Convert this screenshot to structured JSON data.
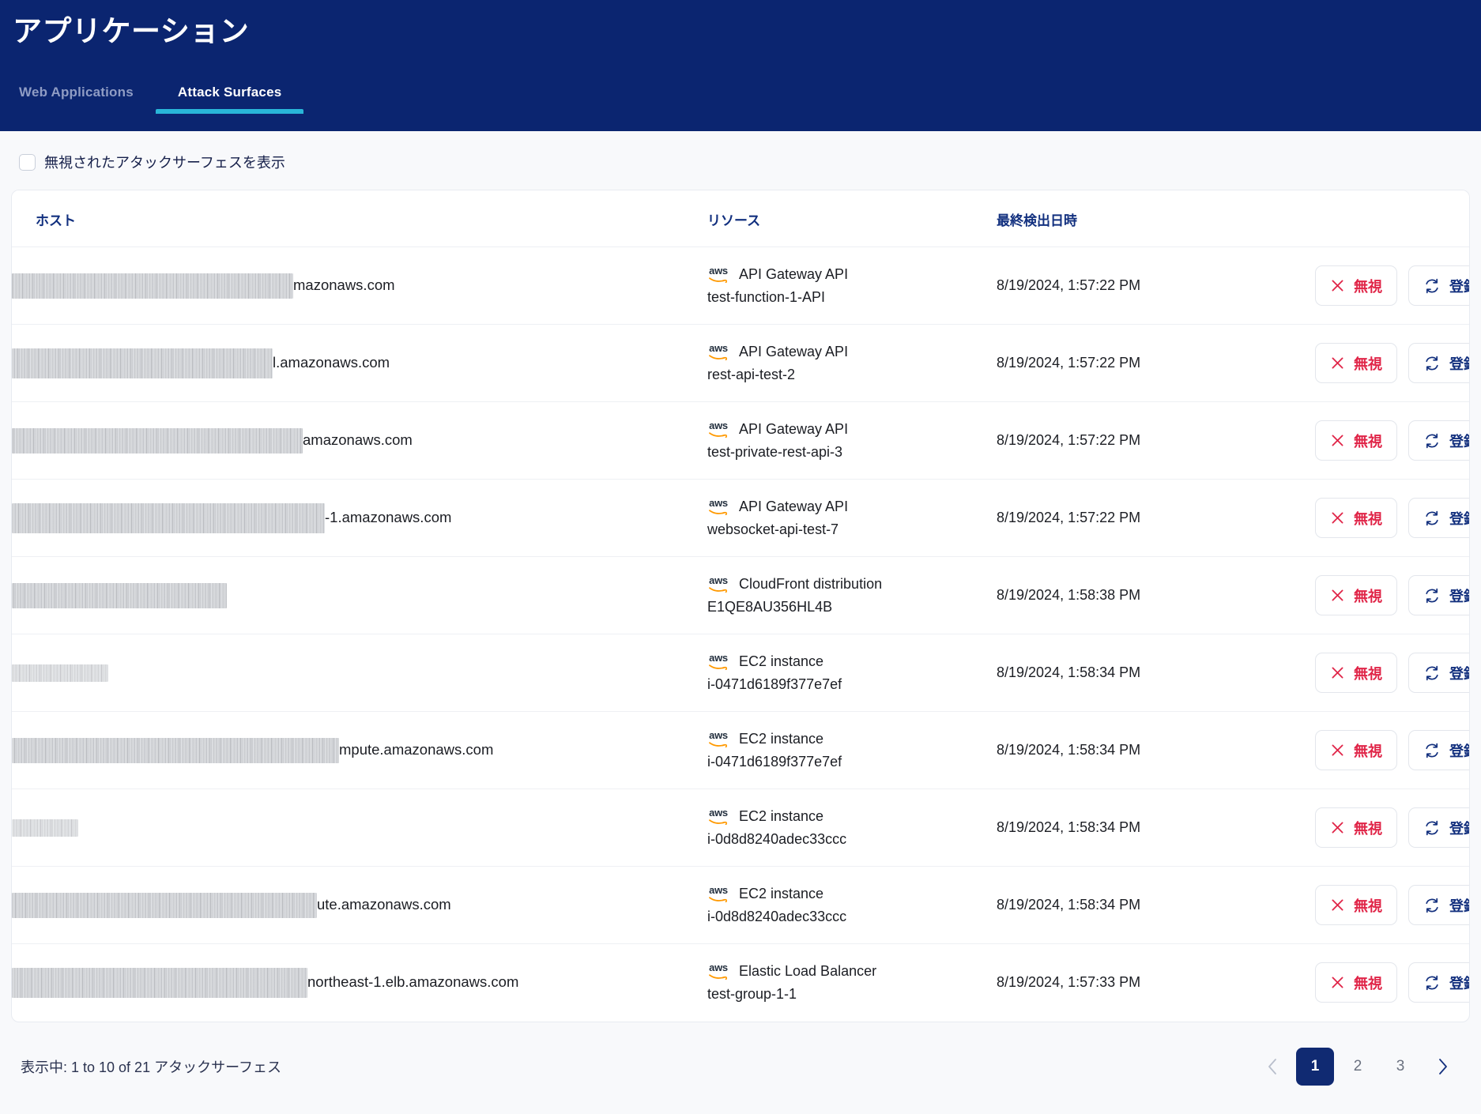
{
  "header": {
    "title": "アプリケーション",
    "tabs": [
      {
        "label": "Web Applications",
        "active": false
      },
      {
        "label": "Attack Surfaces",
        "active": true
      }
    ],
    "bg_color": "#0B2570",
    "accent_color": "#29B6D8"
  },
  "filter": {
    "checkbox_label": "無視されたアタックサーフェスを表示",
    "checked": false
  },
  "table": {
    "columns": {
      "host": "ホスト",
      "resource": "リソース",
      "last_seen": "最終検出日時",
      "actions": ""
    },
    "rows": [
      {
        "host_redacted": true,
        "host_redact_width": 356,
        "host_redact_style": "tall",
        "host_suffix": "mazonaws.com",
        "provider_icon": "aws-logo-icon",
        "resource_type": "API Gateway API",
        "resource_id": "test-function-1-API",
        "last_seen": "8/19/2024, 1:57:22 PM",
        "ignore_label": "無視",
        "register_label": "登録"
      },
      {
        "host_redacted": true,
        "host_redact_width": 330,
        "host_redact_style": "two-line",
        "host_suffix": "l.amazonaws.com",
        "provider_icon": "aws-logo-icon",
        "resource_type": "API Gateway API",
        "resource_id": "rest-api-test-2",
        "last_seen": "8/19/2024, 1:57:22 PM",
        "ignore_label": "無視",
        "register_label": "登録"
      },
      {
        "host_redacted": true,
        "host_redact_width": 368,
        "host_redact_style": "tall",
        "host_suffix": "amazonaws.com",
        "provider_icon": "aws-logo-icon",
        "resource_type": "API Gateway API",
        "resource_id": "test-private-rest-api-3",
        "last_seen": "8/19/2024, 1:57:22 PM",
        "ignore_label": "無視",
        "register_label": "登録"
      },
      {
        "host_redacted": true,
        "host_redact_width": 396,
        "host_redact_style": "two-line",
        "host_suffix": "-1.amazonaws.com",
        "provider_icon": "aws-logo-icon",
        "resource_type": "API Gateway API",
        "resource_id": "websocket-api-test-7",
        "last_seen": "8/19/2024, 1:57:22 PM",
        "ignore_label": "無視",
        "register_label": "登録"
      },
      {
        "host_redacted": true,
        "host_redact_width": 272,
        "host_redact_style": "tall",
        "host_suffix": "",
        "provider_icon": "aws-logo-icon",
        "resource_type": "CloudFront distribution",
        "resource_id": "E1QE8AU356HL4B",
        "last_seen": "8/19/2024, 1:58:38 PM",
        "ignore_label": "無視",
        "register_label": "登録"
      },
      {
        "host_redacted": true,
        "host_redact_width": 122,
        "host_redact_style": "light",
        "host_suffix": "",
        "provider_icon": "aws-logo-icon",
        "resource_type": "EC2 instance",
        "resource_id": "i-0471d6189f377e7ef",
        "last_seen": "8/19/2024, 1:58:34 PM",
        "ignore_label": "無視",
        "register_label": "登録"
      },
      {
        "host_redacted": true,
        "host_redact_width": 414,
        "host_redact_style": "tall",
        "host_suffix": "mpute.amazonaws.com",
        "provider_icon": "aws-logo-icon",
        "resource_type": "EC2 instance",
        "resource_id": "i-0471d6189f377e7ef",
        "last_seen": "8/19/2024, 1:58:34 PM",
        "ignore_label": "無視",
        "register_label": "登録"
      },
      {
        "host_redacted": true,
        "host_redact_width": 84,
        "host_redact_style": "light",
        "host_suffix": "",
        "provider_icon": "aws-logo-icon",
        "resource_type": "EC2 instance",
        "resource_id": "i-0d8d8240adec33ccc",
        "last_seen": "8/19/2024, 1:58:34 PM",
        "ignore_label": "無視",
        "register_label": "登録"
      },
      {
        "host_redacted": true,
        "host_redact_width": 386,
        "host_redact_style": "tall",
        "host_suffix": "ute.amazonaws.com",
        "provider_icon": "aws-logo-icon",
        "resource_type": "EC2 instance",
        "resource_id": "i-0d8d8240adec33ccc",
        "last_seen": "8/19/2024, 1:58:34 PM",
        "ignore_label": "無視",
        "register_label": "登録"
      },
      {
        "host_redacted": true,
        "host_redact_width": 374,
        "host_redact_style": "two-line",
        "host_suffix": "northeast-1.elb.amazonaws.com",
        "provider_icon": "aws-logo-icon",
        "resource_type": "Elastic Load Balancer",
        "resource_id": "test-group-1-1",
        "last_seen": "8/19/2024, 1:57:33 PM",
        "ignore_label": "無視",
        "register_label": "登録"
      }
    ]
  },
  "footer": {
    "count_text": "表示中: 1 to 10 of 21 アタックサーフェス",
    "pagination": {
      "prev_label": "‹",
      "next_label": "›",
      "prev_enabled": false,
      "next_enabled": true,
      "pages": [
        "1",
        "2",
        "3"
      ],
      "current_page": "1"
    }
  },
  "colors": {
    "header_navy": "#0B2570",
    "tab_accent_cyan": "#29B6D8",
    "ignore_red": "#E02548",
    "register_navy": "#13307E",
    "page_bg": "#F8F9FB"
  }
}
